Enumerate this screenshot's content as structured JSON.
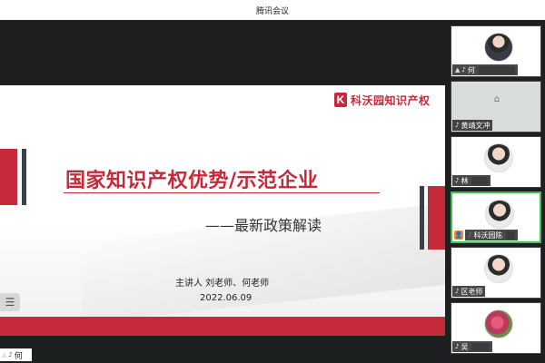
{
  "window": {
    "title": "腾讯会议"
  },
  "slide": {
    "logo_mark": "K",
    "logo_name": "科沃园知识产权",
    "title": "国家知识产权优势/示范企业",
    "subtitle": "——最新政策解读",
    "presenter": "主讲人  刘老师、何老师",
    "date": "2022.06.09",
    "menu_icon": "☰"
  },
  "host_tag": {
    "name": "何"
  },
  "participants": [
    {
      "name": "何",
      "avatar": "portrait-man"
    },
    {
      "name": "黄靖文冲",
      "avatar": "placeholder"
    },
    {
      "name": "林",
      "avatar": "portrait-woman"
    },
    {
      "name": "科沃园陈",
      "avatar": "portrait-woman",
      "speaking": true
    },
    {
      "name": "区老师",
      "avatar": "portrait-woman"
    },
    {
      "name": "吴",
      "avatar": "flower"
    }
  ],
  "colors": {
    "brand_red": "#c52a3b",
    "dark_bar": "#3a4049",
    "speaking_green": "#3fbf55"
  }
}
